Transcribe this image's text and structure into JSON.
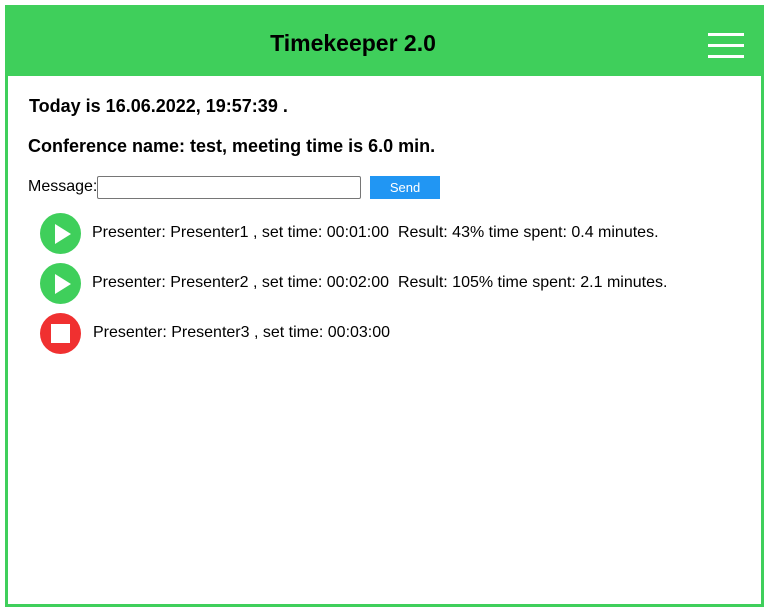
{
  "header": {
    "title": "Timekeeper 2.0",
    "menu_icon": "hamburger-menu-icon"
  },
  "today_text": "Today is 16.06.2022, 19:57:39 .",
  "conference_text": "Conference name: test, meeting time is 6.0 min.",
  "message": {
    "label": "Message:",
    "value": "",
    "placeholder": ""
  },
  "send_label": "Send",
  "colors": {
    "accent": "#3fcf5b",
    "send": "#2196f3",
    "stop": "#f03030"
  },
  "presenters": [
    {
      "icon": "play-icon",
      "text": "Presenter: Presenter1 , set time: 00:01:00  Result: 43% time spent: 0.4 minutes."
    },
    {
      "icon": "play-icon",
      "text": "Presenter: Presenter2 , set time: 00:02:00  Result: 105% time spent: 2.1 minutes."
    },
    {
      "icon": "stop-icon",
      "text": "Presenter: Presenter3 , set time: 00:03:00"
    }
  ]
}
